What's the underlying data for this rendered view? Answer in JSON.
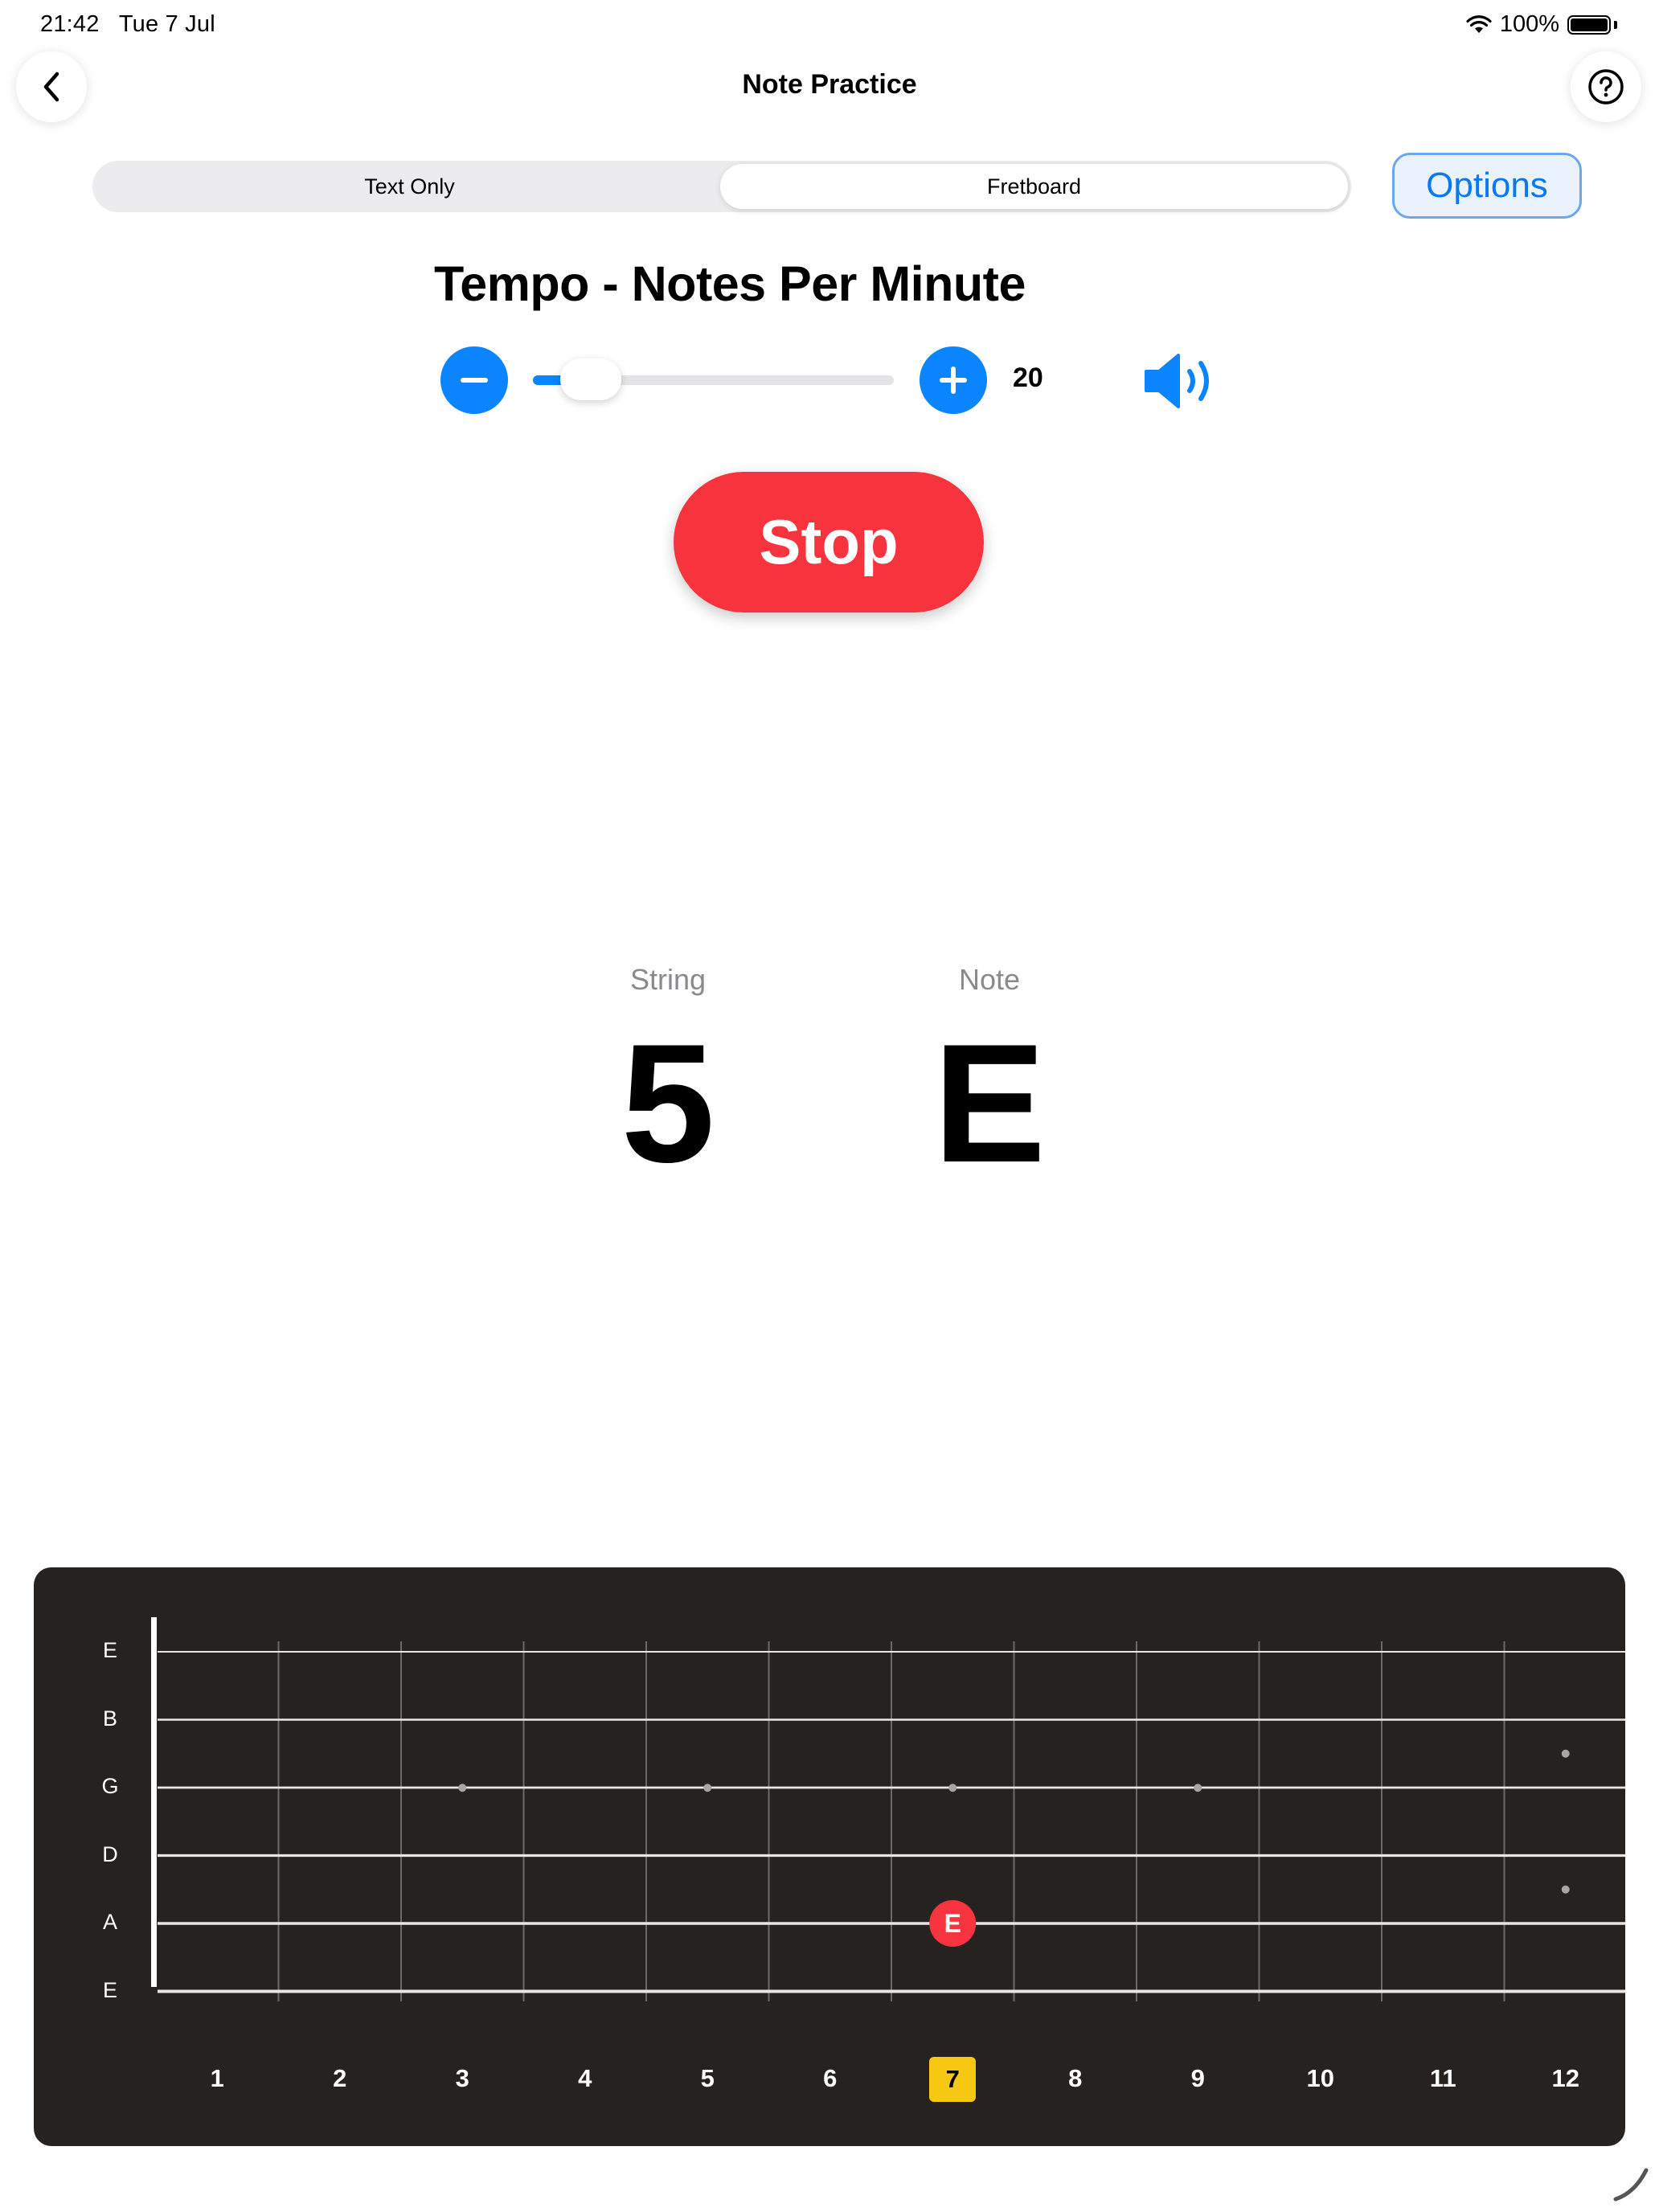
{
  "status_bar": {
    "time": "21:42",
    "date": "Tue 7 Jul",
    "battery": "100%"
  },
  "nav": {
    "title": "Note Practice"
  },
  "mode_tabs": [
    {
      "label": "Text Only",
      "selected": false
    },
    {
      "label": "Fretboard",
      "selected": true
    }
  ],
  "options_label": "Options",
  "tempo": {
    "title": "Tempo - Notes Per Minute",
    "value": "20",
    "slider_fraction": 0.12
  },
  "stop_label": "Stop",
  "prompt": {
    "string_label": "String",
    "string_value": "5",
    "note_label": "Note",
    "note_value": "E"
  },
  "fretboard": {
    "strings": [
      "E",
      "B",
      "G",
      "D",
      "A",
      "E"
    ],
    "frets": [
      "1",
      "2",
      "3",
      "4",
      "5",
      "6",
      "7",
      "8",
      "9",
      "10",
      "11",
      "12"
    ],
    "highlighted_fret": "7",
    "marker": {
      "string": 5,
      "fret": 7,
      "label": "E"
    }
  },
  "colors": {
    "accent": "#0a84ff",
    "stop": "#f7343e",
    "fretboard_bg": "#262220",
    "highlight": "#f6c812"
  }
}
